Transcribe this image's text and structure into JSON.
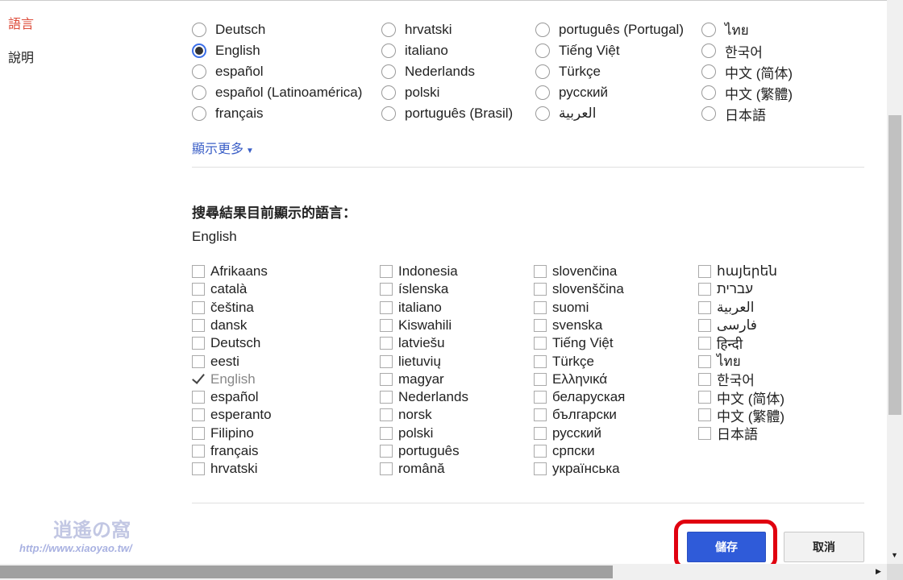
{
  "sidebar": {
    "items": [
      {
        "label": "語言",
        "active": true
      },
      {
        "label": "說明",
        "active": false
      }
    ]
  },
  "interface_languages": {
    "options": [
      "Deutsch",
      "English",
      "español",
      "español (Latinoamérica)",
      "français",
      "hrvatski",
      "italiano",
      "Nederlands",
      "polski",
      "português (Brasil)",
      "português (Portugal)",
      "Tiếng Việt",
      "Türkçe",
      "русский",
      "العربية",
      "ไทย",
      "한국어",
      "中文 (简体)",
      "中文 (繁體)",
      "日本語"
    ],
    "selected": "English",
    "show_more": "顯示更多"
  },
  "search_languages": {
    "heading": "搜尋結果目前顯示的語言：",
    "current": "English",
    "options": [
      "Afrikaans",
      "català",
      "čeština",
      "dansk",
      "Deutsch",
      "eesti",
      "English",
      "español",
      "esperanto",
      "Filipino",
      "français",
      "hrvatski",
      "Indonesia",
      "íslenska",
      "italiano",
      "Kiswahili",
      "latviešu",
      "lietuvių",
      "magyar",
      "Nederlands",
      "norsk",
      "polski",
      "português",
      "română",
      "slovenčina",
      "slovenščina",
      "suomi",
      "svenska",
      "Tiếng Việt",
      "Türkçe",
      "Ελληνικά",
      "беларуская",
      "български",
      "русский",
      "српски",
      "українська",
      "հայերեն",
      "עברית",
      "العربية",
      "فارسی",
      "हिन्दी",
      "ไทย",
      "한국어",
      "中文 (简体)",
      "中文 (繁體)",
      "日本語"
    ],
    "checked": [
      "English"
    ]
  },
  "buttons": {
    "save": "儲存",
    "cancel": "取消"
  },
  "watermark": {
    "logo": "逍遙の窩",
    "url": "http://www.xiaoyao.tw/"
  },
  "colors": {
    "accent": "#3b6ee8",
    "active_sidebar": "#dd4b39",
    "save_bg": "#2f5bd9",
    "highlight": "#e0000f",
    "link": "#3b5fc7"
  }
}
